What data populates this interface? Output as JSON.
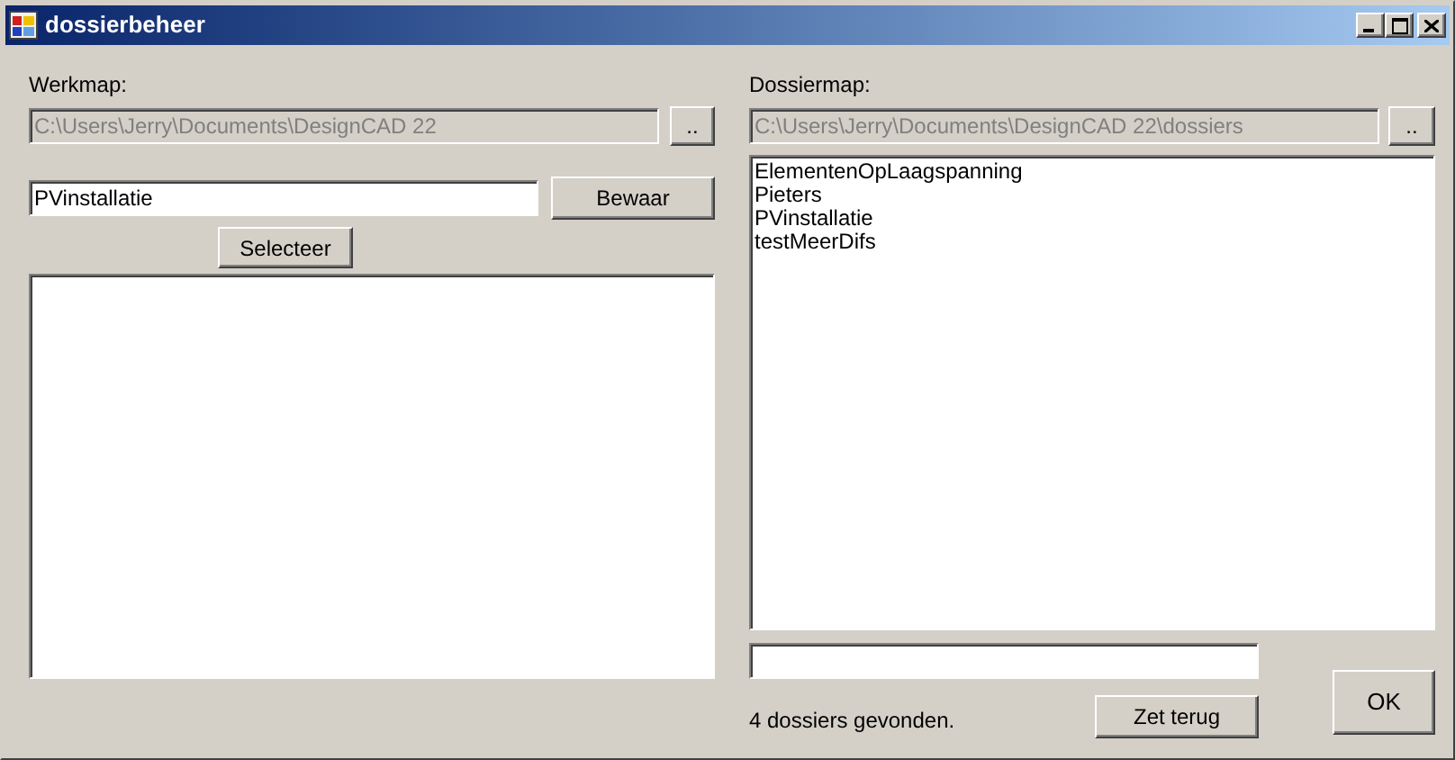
{
  "window": {
    "title": "dossierbeheer"
  },
  "left": {
    "label": "Werkmap:",
    "path_field": {
      "value": "C:\\Users\\Jerry\\Documents\\DesignCAD 22",
      "disabled": true
    },
    "browse_button": "..",
    "name_field": {
      "value": "PVinstallatie",
      "disabled": false
    },
    "save_button": "Bewaar",
    "select_button": "Selecteer"
  },
  "right": {
    "label": "Dossiermap:",
    "path_field": {
      "value": "C:\\Users\\Jerry\\Documents\\DesignCAD 22\\dossiers",
      "disabled": true
    },
    "browse_button": "..",
    "dossiers": [
      "ElementenOpLaagspanning",
      "Pieters",
      "PVinstallatie",
      "testMeerDifs"
    ],
    "status": "4 dossiers gevonden.",
    "reset_button": "Zet terug"
  },
  "ok_button": "OK"
}
